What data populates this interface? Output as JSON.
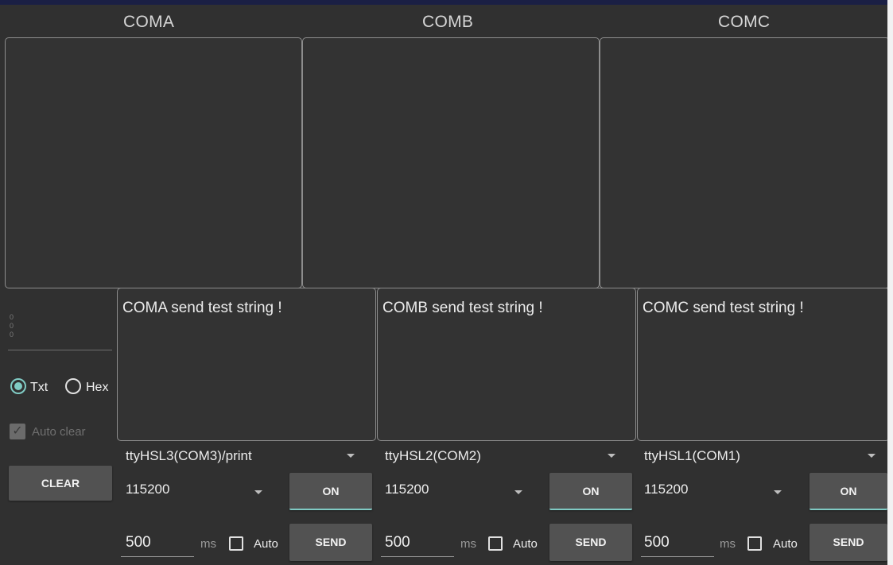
{
  "columns": [
    {
      "title": "COMA",
      "tx_text": "COMA send test string !",
      "port": "ttyHSL3(COM3)/print",
      "baud": "115200",
      "on_label": "ON",
      "interval": "500",
      "ms_label": "ms",
      "auto_label": "Auto",
      "send_label": "SEND"
    },
    {
      "title": "COMB",
      "tx_text": "COMB send test string !",
      "port": "ttyHSL2(COM2)",
      "baud": "115200",
      "on_label": "ON",
      "interval": "500",
      "ms_label": "ms",
      "auto_label": "Auto",
      "send_label": "SEND"
    },
    {
      "title": "COMC",
      "tx_text": "COMC send test string !",
      "port": "ttyHSL1(COM1)",
      "baud": "115200",
      "on_label": "ON",
      "interval": "500",
      "ms_label": "ms",
      "auto_label": "Auto",
      "send_label": "SEND"
    }
  ],
  "left_panel": {
    "counters": [
      "0",
      "0",
      "0"
    ],
    "format_txt": "Txt",
    "format_hex": "Hex",
    "selected_format": "Txt",
    "auto_clear_label": "Auto clear",
    "auto_clear_checked": true,
    "clear_label": "CLEAR"
  },
  "colors": {
    "background": "#303030",
    "accent": "#80cbc4",
    "button": "#525252",
    "border": "#8d8d8d"
  }
}
